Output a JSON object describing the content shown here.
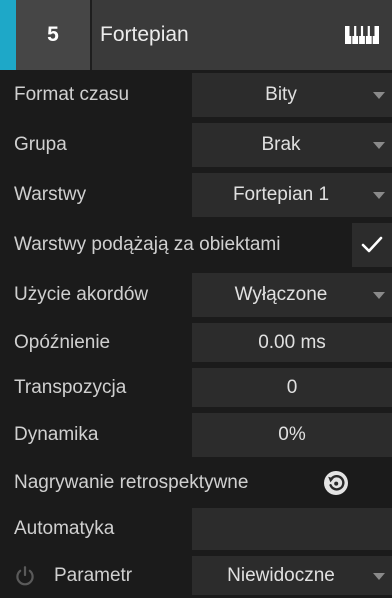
{
  "header": {
    "track_number": "5",
    "track_name": "Fortepian",
    "accent_color": "#1ea8c8",
    "instrument_icon": "piano-keyboard-icon"
  },
  "rows": {
    "time_format": {
      "label": "Format czasu",
      "value": "Bity"
    },
    "group": {
      "label": "Grupa",
      "value": "Brak"
    },
    "layers": {
      "label": "Warstwy",
      "value": "Fortepian 1"
    },
    "layers_follow": {
      "label": "Warstwy podążają za obiektami",
      "checked": true
    },
    "chord_usage": {
      "label": "Użycie akordów",
      "value": "Wyłączone"
    },
    "delay": {
      "label": "Opóźnienie",
      "value": "0.00 ms"
    },
    "transpose": {
      "label": "Transpozycja",
      "value": "0"
    },
    "dynamics": {
      "label": "Dynamika",
      "value": "0%"
    },
    "retro_record": {
      "label": "Nagrywanie retrospektywne",
      "icon": "history-icon"
    },
    "automation": {
      "label": "Automatyka"
    },
    "parameter": {
      "label": "Parametr",
      "value": "Niewidoczne",
      "icon": "power-icon"
    }
  }
}
